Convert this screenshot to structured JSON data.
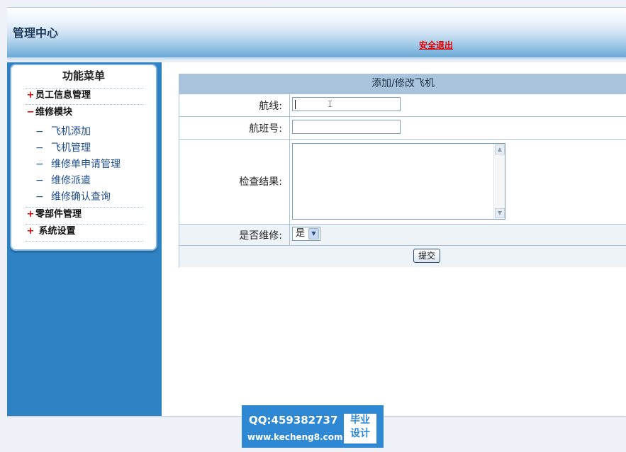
{
  "header": {
    "title": "管理中心",
    "logout": "安全退出"
  },
  "sidebar": {
    "menu_title": "功能菜单",
    "items": [
      {
        "symbol": "+",
        "label": "员工信息管理"
      },
      {
        "symbol": "−",
        "label": "维修模块"
      },
      {
        "symbol": "+",
        "label": "零部件管理"
      },
      {
        "symbol": "+",
        "label": " 系统设置"
      }
    ],
    "subitems": [
      {
        "dash": "−",
        "label": "飞机添加"
      },
      {
        "dash": "−",
        "label": "飞机管理"
      },
      {
        "dash": "−",
        "label": "维修单申请管理"
      },
      {
        "dash": "−",
        "label": "维修派遣"
      },
      {
        "dash": "−",
        "label": "维修确认查询"
      }
    ]
  },
  "form": {
    "title": "添加/修改飞机",
    "route_label": "航线:",
    "route_value": "",
    "flight_label": "航班号:",
    "flight_value": "",
    "result_label": "检查结果:",
    "result_value": "",
    "repair_label": "是否维修:",
    "repair_selected": "是",
    "submit_label": "提交"
  },
  "watermark": {
    "qq": "QQ:459382737",
    "site": "www.kecheng8.com",
    "seal_line1": "毕业",
    "seal_line2": "设计"
  }
}
